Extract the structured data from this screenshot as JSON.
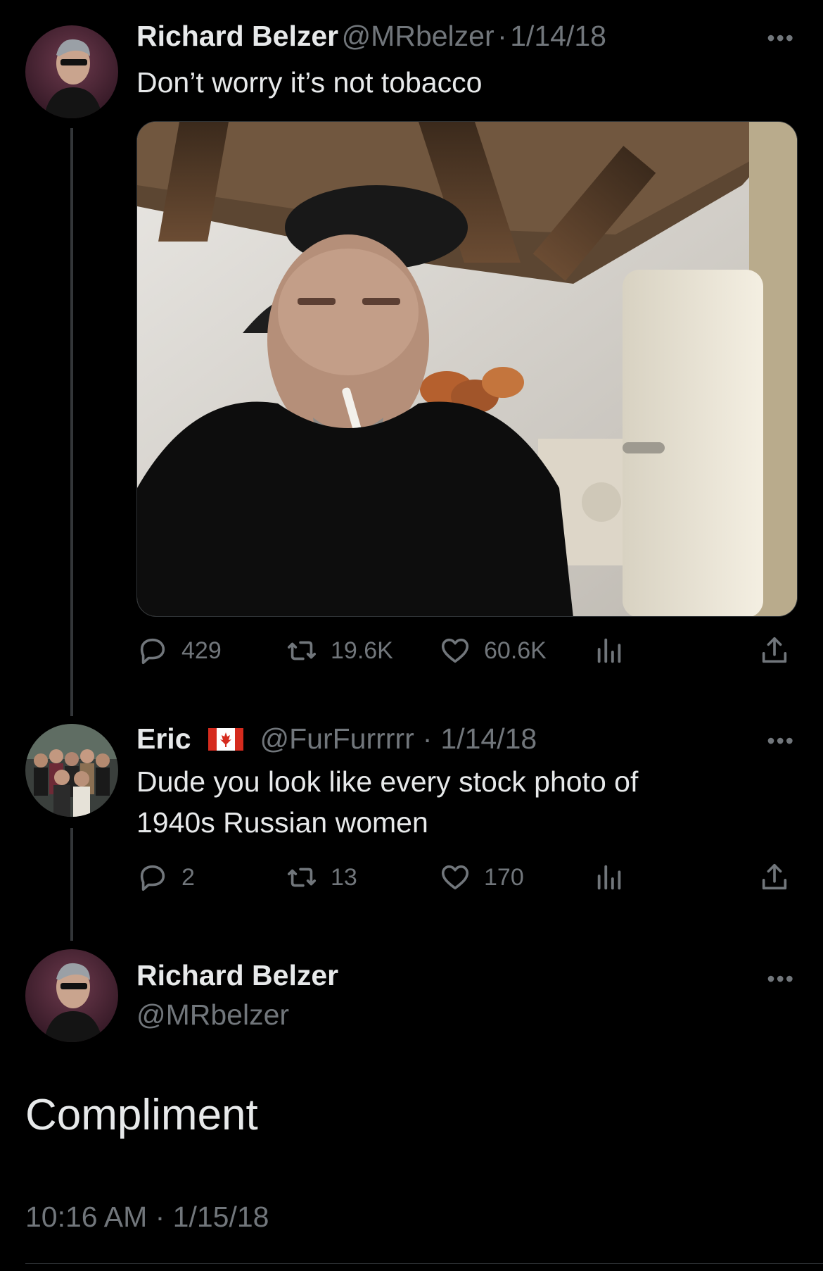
{
  "tweets": [
    {
      "name": "Richard Belzer",
      "handle": "@MRbelzer",
      "sep": "·",
      "date": "1/14/18",
      "text": "Don’t worry it’s not tobacco",
      "replies": "429",
      "retweets": "19.6K",
      "likes": "60.6K"
    },
    {
      "name": "Eric",
      "flag": "🇨🇦",
      "handle": "@FurFurrrrr",
      "sep": "·",
      "date": "1/14/18",
      "text_line1": "Dude you look like every stock photo of",
      "text_line2": "1940s Russian women",
      "replies": "2",
      "retweets": "13",
      "likes": "170"
    }
  ],
  "main": {
    "name": "Richard Belzer",
    "handle": "@MRbelzer",
    "text": "Compliment",
    "timestamp": "10:16 AM · 1/15/18"
  },
  "more_glyph": "•••",
  "colors": {
    "background": "#000000",
    "text": "#e7e9ea",
    "muted": "#71767b",
    "line": "#333639"
  },
  "icons": [
    "reply-icon",
    "retweet-icon",
    "like-icon",
    "analytics-icon",
    "share-icon",
    "more-icon"
  ]
}
